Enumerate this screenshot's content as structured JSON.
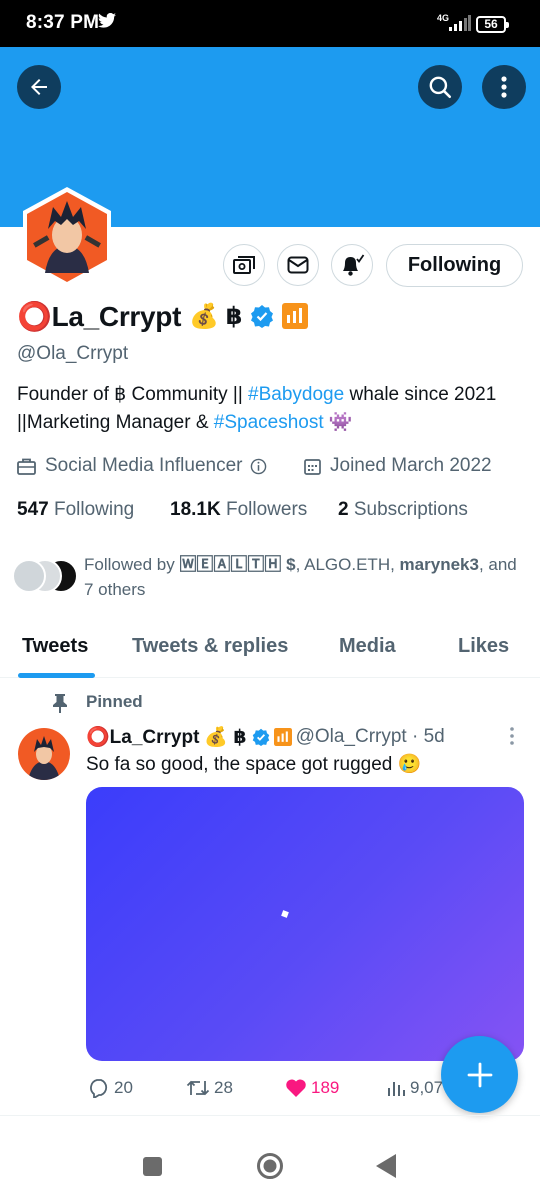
{
  "status_bar": {
    "time": "8:37 PM",
    "network": "4G",
    "battery": "56"
  },
  "colors": {
    "accent": "#1d9bf0",
    "banner": "#1d9bf0",
    "like": "#f91880",
    "text": "#0f1419",
    "muted": "#536471"
  },
  "profile": {
    "name": "⭕La_Crrypt",
    "name_emojis": "💰 ฿",
    "handle": "@Ola_Crrypt",
    "bio": {
      "part1": "Founder of ฿ Community || ",
      "tag1": "#Babydoge",
      "part2": " whale since 2021 ||Marketing Manager & ",
      "tag2": "#Spaceshost",
      "part3": " 👾"
    },
    "category": "Social Media Influencer",
    "joined": "Joined March 2022",
    "following_count": "547",
    "following_label": "Following",
    "followers_count": "18.1K",
    "followers_label": "Followers",
    "subscriptions_count": "2",
    "subscriptions_label": "Subscriptions",
    "followed_by": {
      "prefix": "Followed by ",
      "user1": "🅆🄴🄰🄻🅃🄷 $",
      "sep1": ", ALGO.ETH, ",
      "user2": "marynek3",
      "suffix": ", and 7 others"
    }
  },
  "actions": {
    "following_button": "Following"
  },
  "tabs": [
    "Tweets",
    "Tweets & replies",
    "Media",
    "Likes"
  ],
  "tweet": {
    "pinned_label": "Pinned",
    "author": "⭕La_Crrypt",
    "author_emojis": "💰 ฿",
    "handle_time": "@Ola_Crrypt · 5d",
    "text": "So fa so good, the space got rugged 🥲",
    "replies": "20",
    "retweets": "28",
    "likes": "189",
    "views": "9,07"
  },
  "icons": [
    "back-arrow-icon",
    "search-icon",
    "more-vertical-icon",
    "subscribe-money-icon",
    "mail-icon",
    "bell-icon",
    "calendar-icon",
    "briefcase-icon",
    "info-icon",
    "verified-badge-icon",
    "pin-icon",
    "reply-icon",
    "retweet-icon",
    "heart-icon",
    "views-icon",
    "plus-icon"
  ]
}
